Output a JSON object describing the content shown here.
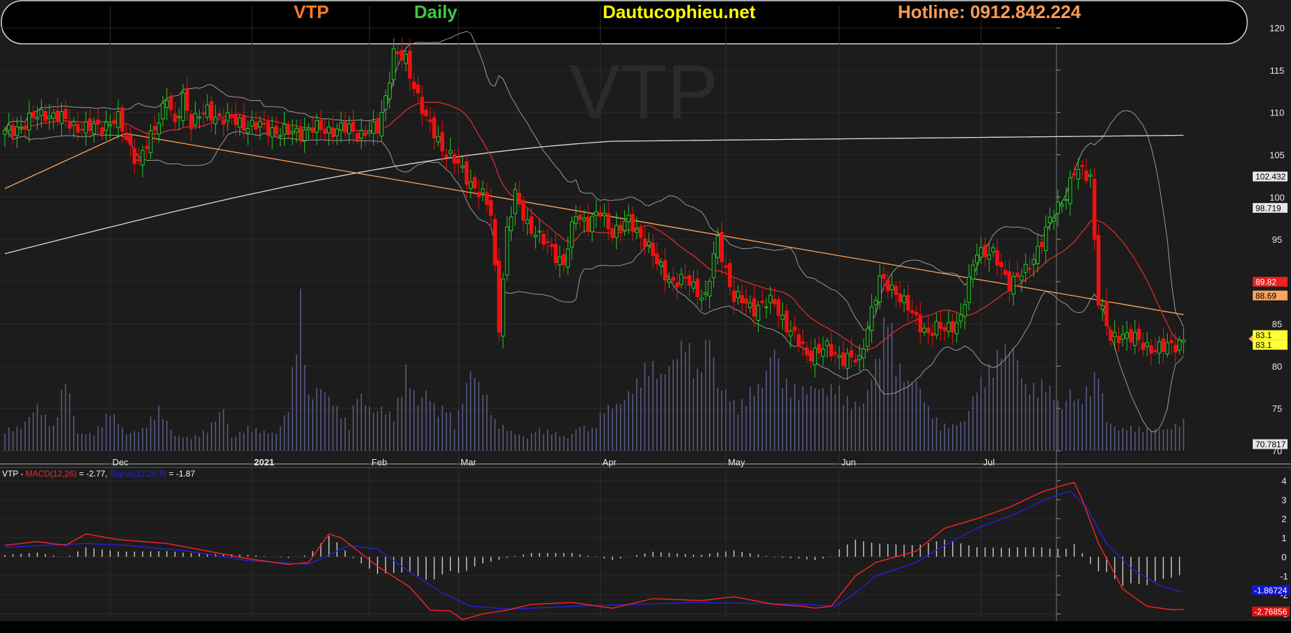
{
  "header": {
    "ticker": "VTP",
    "period": "Daily",
    "site": "Dautucophieu.net",
    "hotline": "Hotline: 0912.842.224"
  },
  "colors": {
    "ticker": "#ff7a2a",
    "period": "#3dc83d",
    "site": "#ffff00",
    "hotline": "#ff9a55",
    "up": "#22cc22",
    "down": "#ee1111",
    "ma_fast": "#e02a2a",
    "ma_mid": "#ffa35a",
    "ma_long": "#dddddd",
    "band": "#9a9a9a",
    "volume": "#5a5a86",
    "macd": "#ff2222",
    "signal": "#2222dd"
  },
  "watermark": "VTP",
  "macd_legend": {
    "prefix": "VTP - ",
    "macd_label": "MACD(12,26)",
    "macd_value": " = -2.77, ",
    "signal_label": "Signal(12,26,9)",
    "signal_value": " = -1.87"
  },
  "chart_data": [
    {
      "type": "candlestick",
      "ticker": "VTP",
      "ylim": [
        70,
        121
      ],
      "yticks": [
        70,
        75,
        80,
        85,
        90,
        95,
        100,
        105,
        110,
        115,
        120
      ],
      "xlabels": [
        "Dec",
        "2021",
        "Feb",
        "Mar",
        "Apr",
        "May",
        "Jun",
        "Jul"
      ],
      "price_tags": [
        {
          "label": "102.432",
          "value": 102.432,
          "style": "long"
        },
        {
          "label": "98.719",
          "value": 98.719,
          "style": "long"
        },
        {
          "label": "89.82",
          "value": 89.82,
          "style": "fast"
        },
        {
          "label": "88.69",
          "value": 88.69,
          "style": "mid"
        },
        {
          "label": "83.1",
          "value": 83.1,
          "style": "last"
        },
        {
          "label": "83.1",
          "value": 83.1,
          "style": "last"
        },
        {
          "label": "70.7817",
          "value": 70.7817,
          "style": "long"
        }
      ],
      "close_path": [
        [
          0,
          107.5
        ],
        [
          10,
          110
        ],
        [
          20,
          108
        ],
        [
          28,
          109
        ],
        [
          33,
          104
        ],
        [
          36,
          107
        ],
        [
          40,
          112
        ],
        [
          42,
          108
        ],
        [
          44,
          112
        ],
        [
          46,
          109
        ],
        [
          50,
          110
        ],
        [
          56,
          109
        ],
        [
          66,
          108
        ],
        [
          70,
          107.5
        ],
        [
          75,
          108
        ],
        [
          85,
          108
        ],
        [
          88,
          107.5
        ],
        [
          92,
          108
        ],
        [
          94,
          112
        ],
        [
          96,
          117
        ],
        [
          99,
          116
        ],
        [
          102,
          112
        ],
        [
          104,
          109
        ],
        [
          108,
          106
        ],
        [
          113,
          103
        ],
        [
          118,
          100
        ],
        [
          120,
          98
        ],
        [
          122,
          85
        ],
        [
          124,
          96
        ],
        [
          126,
          100
        ],
        [
          129,
          97
        ],
        [
          132,
          95
        ],
        [
          135,
          94
        ],
        [
          138,
          92
        ],
        [
          141,
          98
        ],
        [
          144,
          97
        ],
        [
          147,
          98
        ],
        [
          150,
          96
        ],
        [
          154,
          97
        ],
        [
          158,
          95
        ],
        [
          161,
          92
        ],
        [
          165,
          90
        ],
        [
          169,
          90
        ],
        [
          173,
          88
        ],
        [
          176,
          95
        ],
        [
          180,
          88
        ],
        [
          185,
          87
        ],
        [
          190,
          87.5
        ],
        [
          194,
          84
        ],
        [
          198,
          81.5
        ],
        [
          203,
          82
        ],
        [
          207,
          81
        ],
        [
          211,
          80.5
        ],
        [
          213,
          85
        ],
        [
          216,
          90
        ],
        [
          220,
          89
        ],
        [
          224,
          86
        ],
        [
          228,
          84
        ],
        [
          232,
          84.5
        ],
        [
          236,
          85.5
        ],
        [
          240,
          94
        ],
        [
          244,
          93
        ],
        [
          248,
          90
        ],
        [
          252,
          91
        ],
        [
          255,
          94
        ],
        [
          258,
          97
        ],
        [
          262,
          100.5
        ],
        [
          264,
          103
        ],
        [
          268,
          102.5
        ],
        [
          270,
          88
        ],
        [
          273,
          83
        ],
        [
          276,
          84
        ],
        [
          281,
          82.5
        ],
        [
          286,
          82
        ],
        [
          291,
          83.1
        ]
      ],
      "volume_max_ref": 100,
      "volume_path": [
        [
          0,
          10
        ],
        [
          4,
          11
        ],
        [
          8,
          21
        ],
        [
          12,
          11
        ],
        [
          15,
          35
        ],
        [
          18,
          8
        ],
        [
          22,
          8
        ],
        [
          26,
          19
        ],
        [
          30,
          8
        ],
        [
          34,
          10
        ],
        [
          38,
          20
        ],
        [
          42,
          7
        ],
        [
          46,
          6
        ],
        [
          50,
          10
        ],
        [
          54,
          20
        ],
        [
          56,
          6
        ],
        [
          60,
          11
        ],
        [
          64,
          9
        ],
        [
          67,
          8
        ],
        [
          70,
          20
        ],
        [
          73,
          71
        ],
        [
          75,
          25
        ],
        [
          78,
          30
        ],
        [
          82,
          20
        ],
        [
          85,
          12
        ],
        [
          87,
          28
        ],
        [
          91,
          18
        ],
        [
          93,
          20
        ],
        [
          96,
          16
        ],
        [
          99,
          38
        ],
        [
          102,
          22
        ],
        [
          104,
          28
        ],
        [
          107,
          18
        ],
        [
          109,
          22
        ],
        [
          111,
          12
        ],
        [
          113,
          24
        ],
        [
          115,
          38
        ],
        [
          119,
          25
        ],
        [
          121,
          14
        ],
        [
          125,
          9
        ],
        [
          129,
          6
        ],
        [
          131,
          10
        ],
        [
          135,
          9
        ],
        [
          139,
          6
        ],
        [
          142,
          12
        ],
        [
          145,
          10
        ],
        [
          148,
          20
        ],
        [
          152,
          22
        ],
        [
          156,
          32
        ],
        [
          159,
          42
        ],
        [
          162,
          35
        ],
        [
          165,
          42
        ],
        [
          168,
          53
        ],
        [
          171,
          36
        ],
        [
          174,
          56
        ],
        [
          176,
          30
        ],
        [
          178,
          28
        ],
        [
          181,
          20
        ],
        [
          184,
          28
        ],
        [
          187,
          31
        ],
        [
          190,
          50
        ],
        [
          192,
          33
        ],
        [
          196,
          28
        ],
        [
          200,
          30
        ],
        [
          203,
          28
        ],
        [
          205,
          31
        ],
        [
          209,
          22
        ],
        [
          212,
          22
        ],
        [
          216,
          48
        ],
        [
          218,
          70
        ],
        [
          220,
          42
        ],
        [
          223,
          32
        ],
        [
          225,
          33
        ],
        [
          228,
          20
        ],
        [
          231,
          12
        ],
        [
          234,
          12
        ],
        [
          237,
          14
        ],
        [
          240,
          30
        ],
        [
          243,
          38
        ],
        [
          246,
          48
        ],
        [
          249,
          48
        ],
        [
          252,
          30
        ],
        [
          254,
          30
        ],
        [
          257,
          32
        ],
        [
          261,
          20
        ],
        [
          263,
          28
        ],
        [
          265,
          23
        ],
        [
          268,
          31
        ],
        [
          270,
          38
        ],
        [
          272,
          14
        ],
        [
          275,
          10
        ],
        [
          278,
          11
        ],
        [
          282,
          10
        ],
        [
          287,
          10
        ],
        [
          291,
          14
        ]
      ]
    },
    {
      "type": "line",
      "name": "MACD",
      "ylim": [
        -3.2,
        4.4
      ],
      "yticks": [
        -3,
        -2,
        -1,
        0,
        1,
        2,
        3,
        4
      ],
      "value_tags": [
        {
          "label": "-1.86724",
          "value": -1.86724,
          "series": "signal"
        },
        {
          "label": "-2.76856",
          "value": -2.76856,
          "series": "macd"
        }
      ],
      "macd_path": [
        [
          0,
          0.6
        ],
        [
          8,
          0.8
        ],
        [
          15,
          0.6
        ],
        [
          20,
          1.2
        ],
        [
          28,
          0.9
        ],
        [
          40,
          0.7
        ],
        [
          50,
          0.3
        ],
        [
          60,
          -0.1
        ],
        [
          70,
          -0.4
        ],
        [
          75,
          -0.3
        ],
        [
          80,
          1.2
        ],
        [
          83,
          1.0
        ],
        [
          86,
          0.5
        ],
        [
          92,
          -0.5
        ],
        [
          100,
          -1.6
        ],
        [
          105,
          -2.8
        ],
        [
          110,
          -2.85
        ],
        [
          113,
          -3.3
        ],
        [
          118,
          -3.0
        ],
        [
          124,
          -2.8
        ],
        [
          130,
          -2.5
        ],
        [
          140,
          -2.4
        ],
        [
          150,
          -2.7
        ],
        [
          160,
          -2.2
        ],
        [
          172,
          -2.3
        ],
        [
          180,
          -2.1
        ],
        [
          190,
          -2.5
        ],
        [
          197,
          -2.6
        ],
        [
          200,
          -2.7
        ],
        [
          204,
          -2.6
        ],
        [
          210,
          -1.0
        ],
        [
          215,
          -0.3
        ],
        [
          225,
          0.3
        ],
        [
          232,
          1.5
        ],
        [
          240,
          2.0
        ],
        [
          248,
          2.6
        ],
        [
          256,
          3.4
        ],
        [
          262,
          3.8
        ],
        [
          264,
          3.9
        ],
        [
          266,
          3.0
        ],
        [
          270,
          0.7
        ],
        [
          276,
          -1.7
        ],
        [
          282,
          -2.6
        ],
        [
          288,
          -2.78
        ],
        [
          291,
          -2.77
        ]
      ],
      "signal_path": [
        [
          0,
          0.5
        ],
        [
          10,
          0.6
        ],
        [
          20,
          0.7
        ],
        [
          30,
          0.6
        ],
        [
          45,
          0.3
        ],
        [
          60,
          -0.2
        ],
        [
          75,
          -0.4
        ],
        [
          85,
          0.6
        ],
        [
          92,
          0.4
        ],
        [
          100,
          -0.8
        ],
        [
          108,
          -1.9
        ],
        [
          115,
          -2.6
        ],
        [
          125,
          -2.75
        ],
        [
          140,
          -2.6
        ],
        [
          155,
          -2.5
        ],
        [
          170,
          -2.4
        ],
        [
          185,
          -2.45
        ],
        [
          198,
          -2.5
        ],
        [
          205,
          -2.6
        ],
        [
          210,
          -1.9
        ],
        [
          215,
          -1.0
        ],
        [
          225,
          -0.3
        ],
        [
          232,
          0.6
        ],
        [
          240,
          1.5
        ],
        [
          250,
          2.3
        ],
        [
          258,
          3.1
        ],
        [
          263,
          3.45
        ],
        [
          267,
          2.6
        ],
        [
          272,
          0.7
        ],
        [
          278,
          -0.6
        ],
        [
          285,
          -1.5
        ],
        [
          291,
          -1.87
        ]
      ]
    }
  ]
}
